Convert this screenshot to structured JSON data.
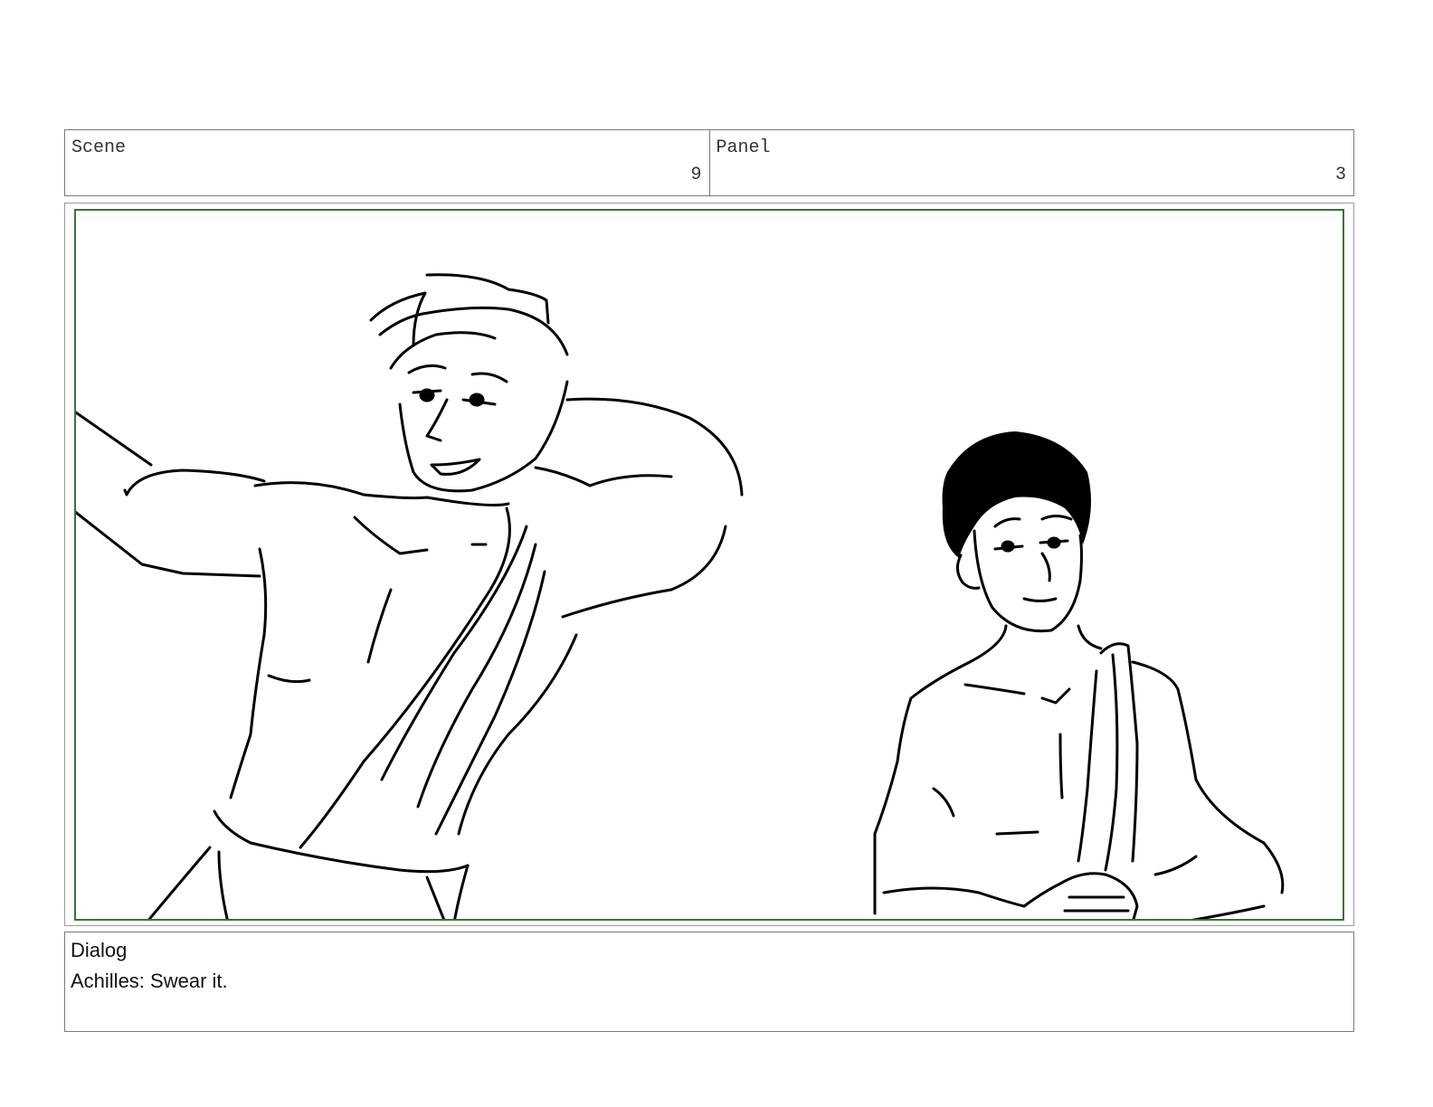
{
  "header": {
    "scene_label": "Scene",
    "scene_value": "9",
    "panel_label": "Panel",
    "panel_value": "3"
  },
  "frame": {
    "border_color": "#2f7a2f"
  },
  "dialog": {
    "label": "Dialog",
    "text": "Achilles: Swear it."
  }
}
